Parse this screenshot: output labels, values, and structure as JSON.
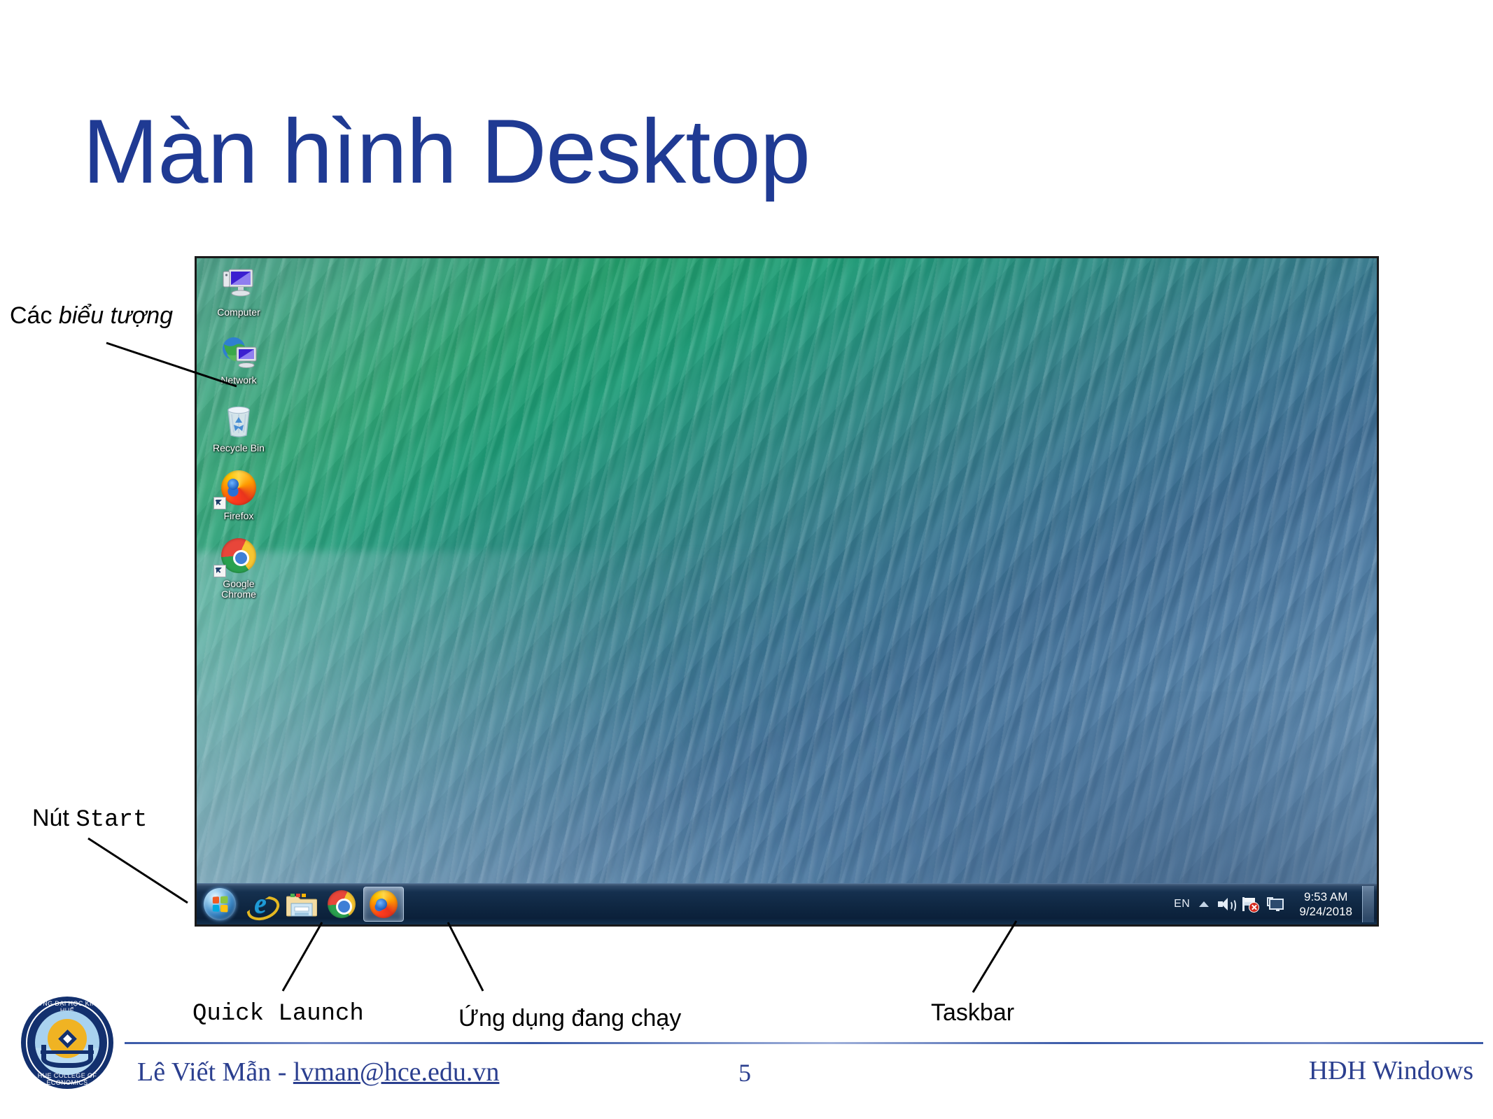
{
  "slide": {
    "title": "Màn hình Desktop",
    "page_number": "5",
    "footer_author": "Lê Viết Mẫn - ",
    "footer_email": "lvman@hce.edu.vn",
    "footer_topic": "HĐH Windows"
  },
  "logo": {
    "top_text": "TRƯỜNG ĐẠI HỌC KINH TẾ HUẾ",
    "bottom_text": "HUE COLLEGE OF ECONOMICS",
    "ring_color": "#13306e",
    "coin_color": "#f0b323"
  },
  "callouts": {
    "icons_prefix": "Các ",
    "icons_emph": "biểu tượng",
    "start_prefix": "Nút ",
    "start_mono": "Start",
    "quick_launch": "Quick Launch",
    "running_app": "Ứng dụng đang chạy",
    "taskbar": "Taskbar"
  },
  "desktop": {
    "wallpaper_name": "ocean-wave-wallpaper",
    "icons": [
      {
        "name": "Computer",
        "icon": "computer-icon",
        "shortcut": false
      },
      {
        "name": "Network",
        "icon": "network-icon",
        "shortcut": false
      },
      {
        "name": "Recycle Bin",
        "icon": "recycle-bin-icon",
        "shortcut": false
      },
      {
        "name": "Firefox",
        "icon": "firefox-icon",
        "shortcut": true
      },
      {
        "name": "Google\nChrome",
        "icon": "chrome-icon",
        "shortcut": true
      }
    ],
    "taskbar": {
      "start_button": "start-orb-icon",
      "quick_launch": [
        {
          "name": "Internet Explorer",
          "icon": "internet-explorer-icon"
        },
        {
          "name": "Windows Explorer",
          "icon": "folder-icon"
        },
        {
          "name": "Google Chrome",
          "icon": "chrome-icon"
        }
      ],
      "running": [
        {
          "name": "Firefox",
          "icon": "firefox-icon",
          "active": true
        }
      ],
      "tray": {
        "language": "EN",
        "show_hidden": "chevron-up-icon",
        "volume": "speaker-icon",
        "action_center": "flag-alert-icon",
        "network": "network-monitor-icon",
        "time": "9:53 AM",
        "date": "9/24/2018"
      }
    }
  },
  "colors": {
    "title_blue": "#1F3A93",
    "footer_blue": "#2b3f8f",
    "taskbar_dark": "#0f2742"
  }
}
